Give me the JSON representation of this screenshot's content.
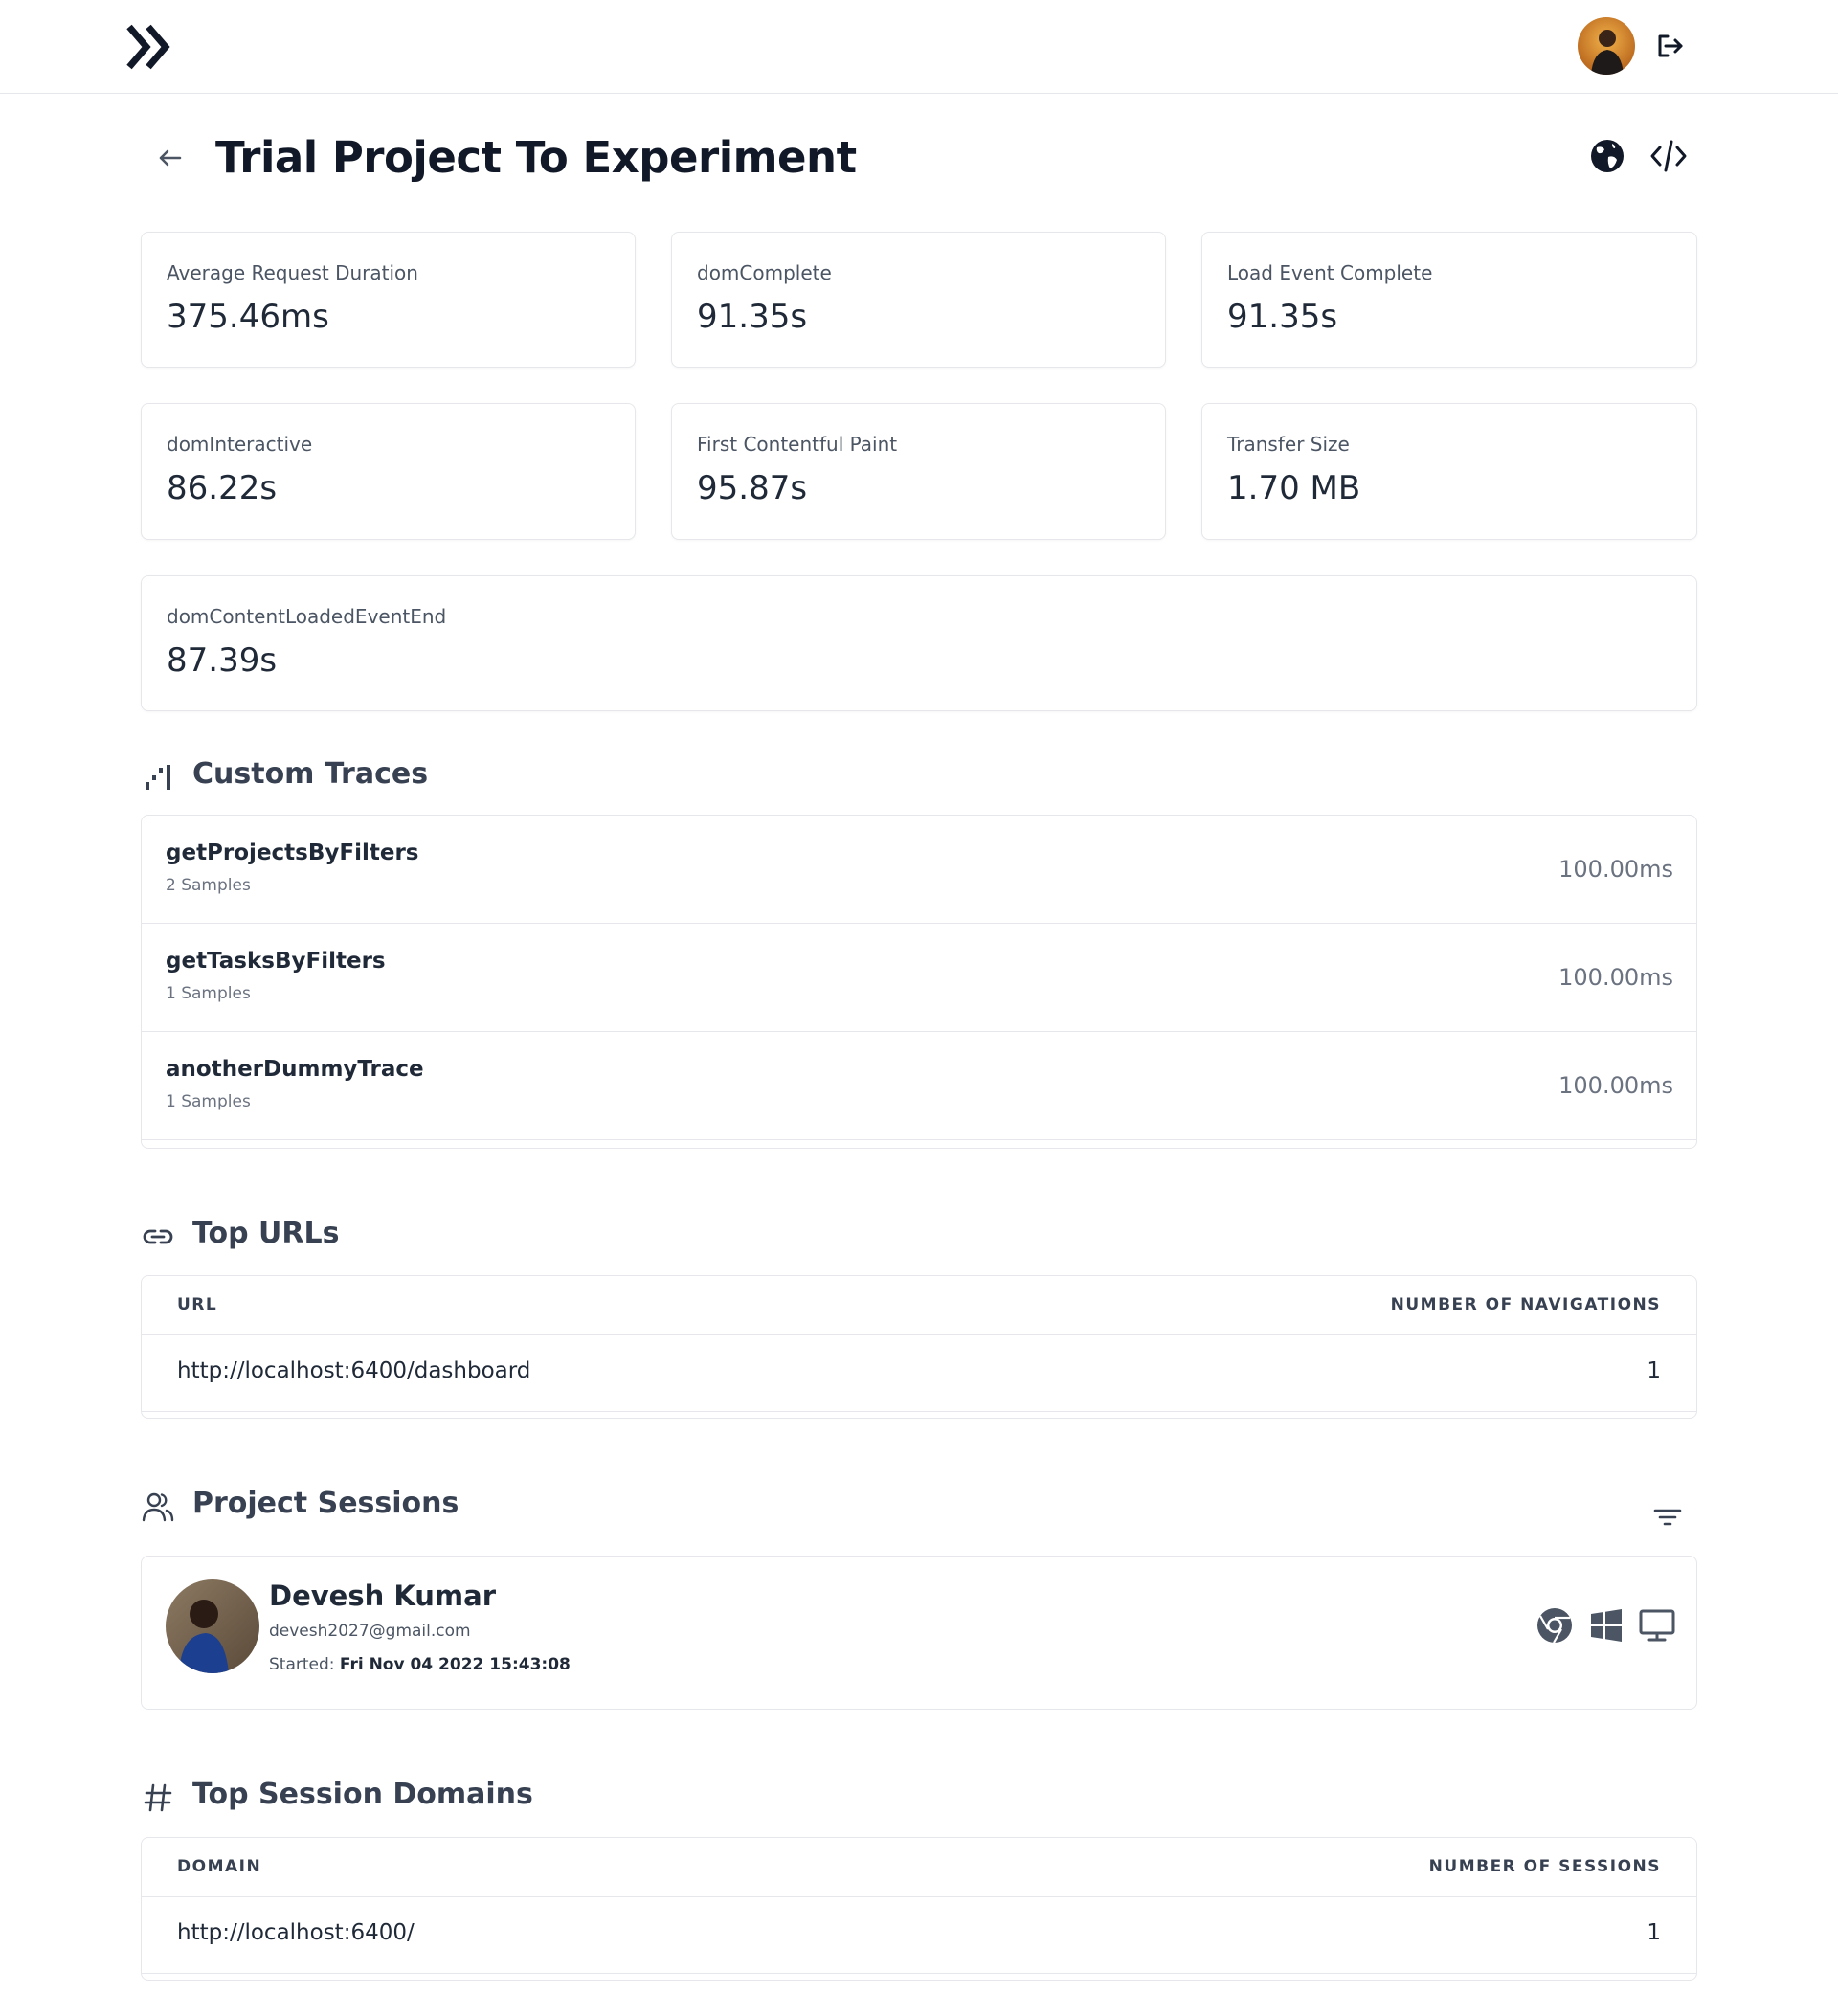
{
  "header": {
    "logo_icon": "double-chevron-right-icon",
    "avatar_icon": "user-avatar",
    "logout_icon": "logout-icon"
  },
  "page": {
    "back_icon": "arrow-left-icon",
    "title": "Trial Project To Experiment",
    "globe_icon": "globe-icon",
    "code_icon": "code-icon"
  },
  "metrics": [
    {
      "label": "Average Request Duration",
      "value": "375.46ms"
    },
    {
      "label": "domComplete",
      "value": "91.35s"
    },
    {
      "label": "Load Event Complete",
      "value": "91.35s"
    },
    {
      "label": "domInteractive",
      "value": "86.22s"
    },
    {
      "label": "First Contentful Paint",
      "value": "95.87s"
    },
    {
      "label": "Transfer Size",
      "value": "1.70 MB"
    },
    {
      "label": "domContentLoadedEventEnd",
      "value": "87.39s"
    }
  ],
  "custom_traces": {
    "title": "Custom Traces",
    "icon": "chart-steps-icon",
    "rows": [
      {
        "name": "getProjectsByFilters",
        "samples": "2 Samples",
        "value": "100.00ms"
      },
      {
        "name": "getTasksByFilters",
        "samples": "1 Samples",
        "value": "100.00ms"
      },
      {
        "name": "anotherDummyTrace",
        "samples": "1 Samples",
        "value": "100.00ms"
      }
    ]
  },
  "top_urls": {
    "title": "Top URLs",
    "icon": "link-icon",
    "col_url": "URL",
    "col_count": "NUMBER OF NAVIGATIONS",
    "rows": [
      {
        "url": "http://localhost:6400/dashboard",
        "count": "1"
      }
    ]
  },
  "sessions": {
    "title": "Project Sessions",
    "icon": "users-icon",
    "filter_icon": "filter-icon",
    "items": [
      {
        "name": "Devesh Kumar",
        "email": "devesh2027@gmail.com",
        "started_label": "Started:",
        "started_value": "Fri Nov 04 2022 15:43:08",
        "browser_icon": "chrome-icon",
        "os_icon": "windows-icon",
        "device_icon": "desktop-icon"
      }
    ]
  },
  "domains": {
    "title": "Top Session Domains",
    "icon": "hash-icon",
    "col_domain": "DOMAIN",
    "col_count": "NUMBER OF SESSIONS",
    "rows": [
      {
        "domain": "http://localhost:6400/",
        "count": "1"
      }
    ]
  }
}
